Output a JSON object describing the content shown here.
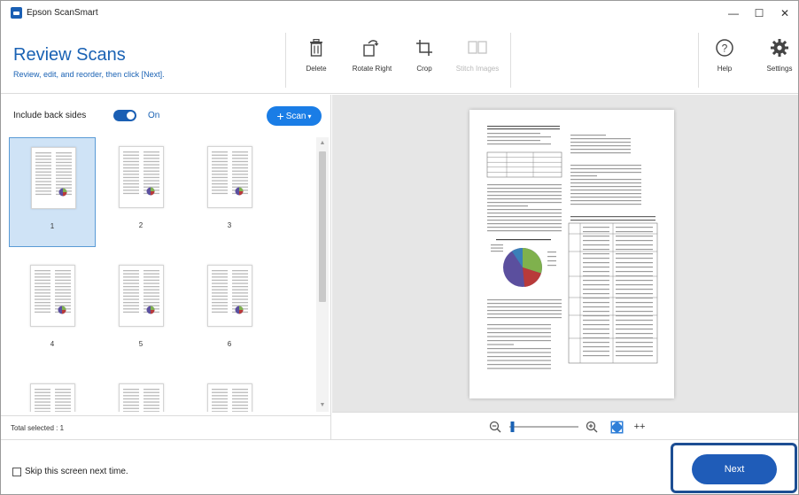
{
  "window": {
    "title": "Epson ScanSmart",
    "minimize_glyph": "—",
    "maximize_glyph": "☐",
    "close_glyph": "✕"
  },
  "header": {
    "title": "Review Scans",
    "subtitle": "Review, edit, and reorder, then click [Next]."
  },
  "toolbar": {
    "delete_label": "Delete",
    "rotate_right_label": "Rotate Right",
    "crop_label": "Crop",
    "stitch_images_label": "Stitch Images",
    "help_label": "Help",
    "settings_label": "Settings"
  },
  "left_panel": {
    "include_back_sides_label": "Include back sides",
    "include_back_sides_state": "On",
    "include_back_sides_on": true,
    "scan_button_label": "Scan",
    "scan_button_plus": "+",
    "scan_button_caret": "▾",
    "thumbnails": [
      {
        "label": "1",
        "selected": true
      },
      {
        "label": "2",
        "selected": false
      },
      {
        "label": "3",
        "selected": false
      },
      {
        "label": "4",
        "selected": false
      },
      {
        "label": "5",
        "selected": false
      },
      {
        "label": "6",
        "selected": false
      },
      {
        "label": "",
        "selected": false
      },
      {
        "label": "",
        "selected": false
      },
      {
        "label": "",
        "selected": false
      }
    ],
    "status_text": "Total selected : 1"
  },
  "zoom_bar": {
    "zoom_out_icon": "zoom-out-icon",
    "zoom_in_icon": "zoom-in-icon",
    "fit_page_icon": "fit-page-icon",
    "expand_glyph": "++",
    "zoom_level": 0.02
  },
  "footer": {
    "skip_label": "Skip this screen next time.",
    "skip_checked": false,
    "next_label": "Next"
  },
  "colors": {
    "accent": "#1a62b4",
    "scan_button": "#1a7de6",
    "next_button": "#1f5cb8",
    "highlight_frame": "#1d4e93",
    "selection": "#cfe3f6",
    "preview_background": "#e6e6e6",
    "pie_slices": [
      "#5b4f9e",
      "#7fb14d",
      "#b83a3a",
      "#3a7fb8"
    ]
  }
}
